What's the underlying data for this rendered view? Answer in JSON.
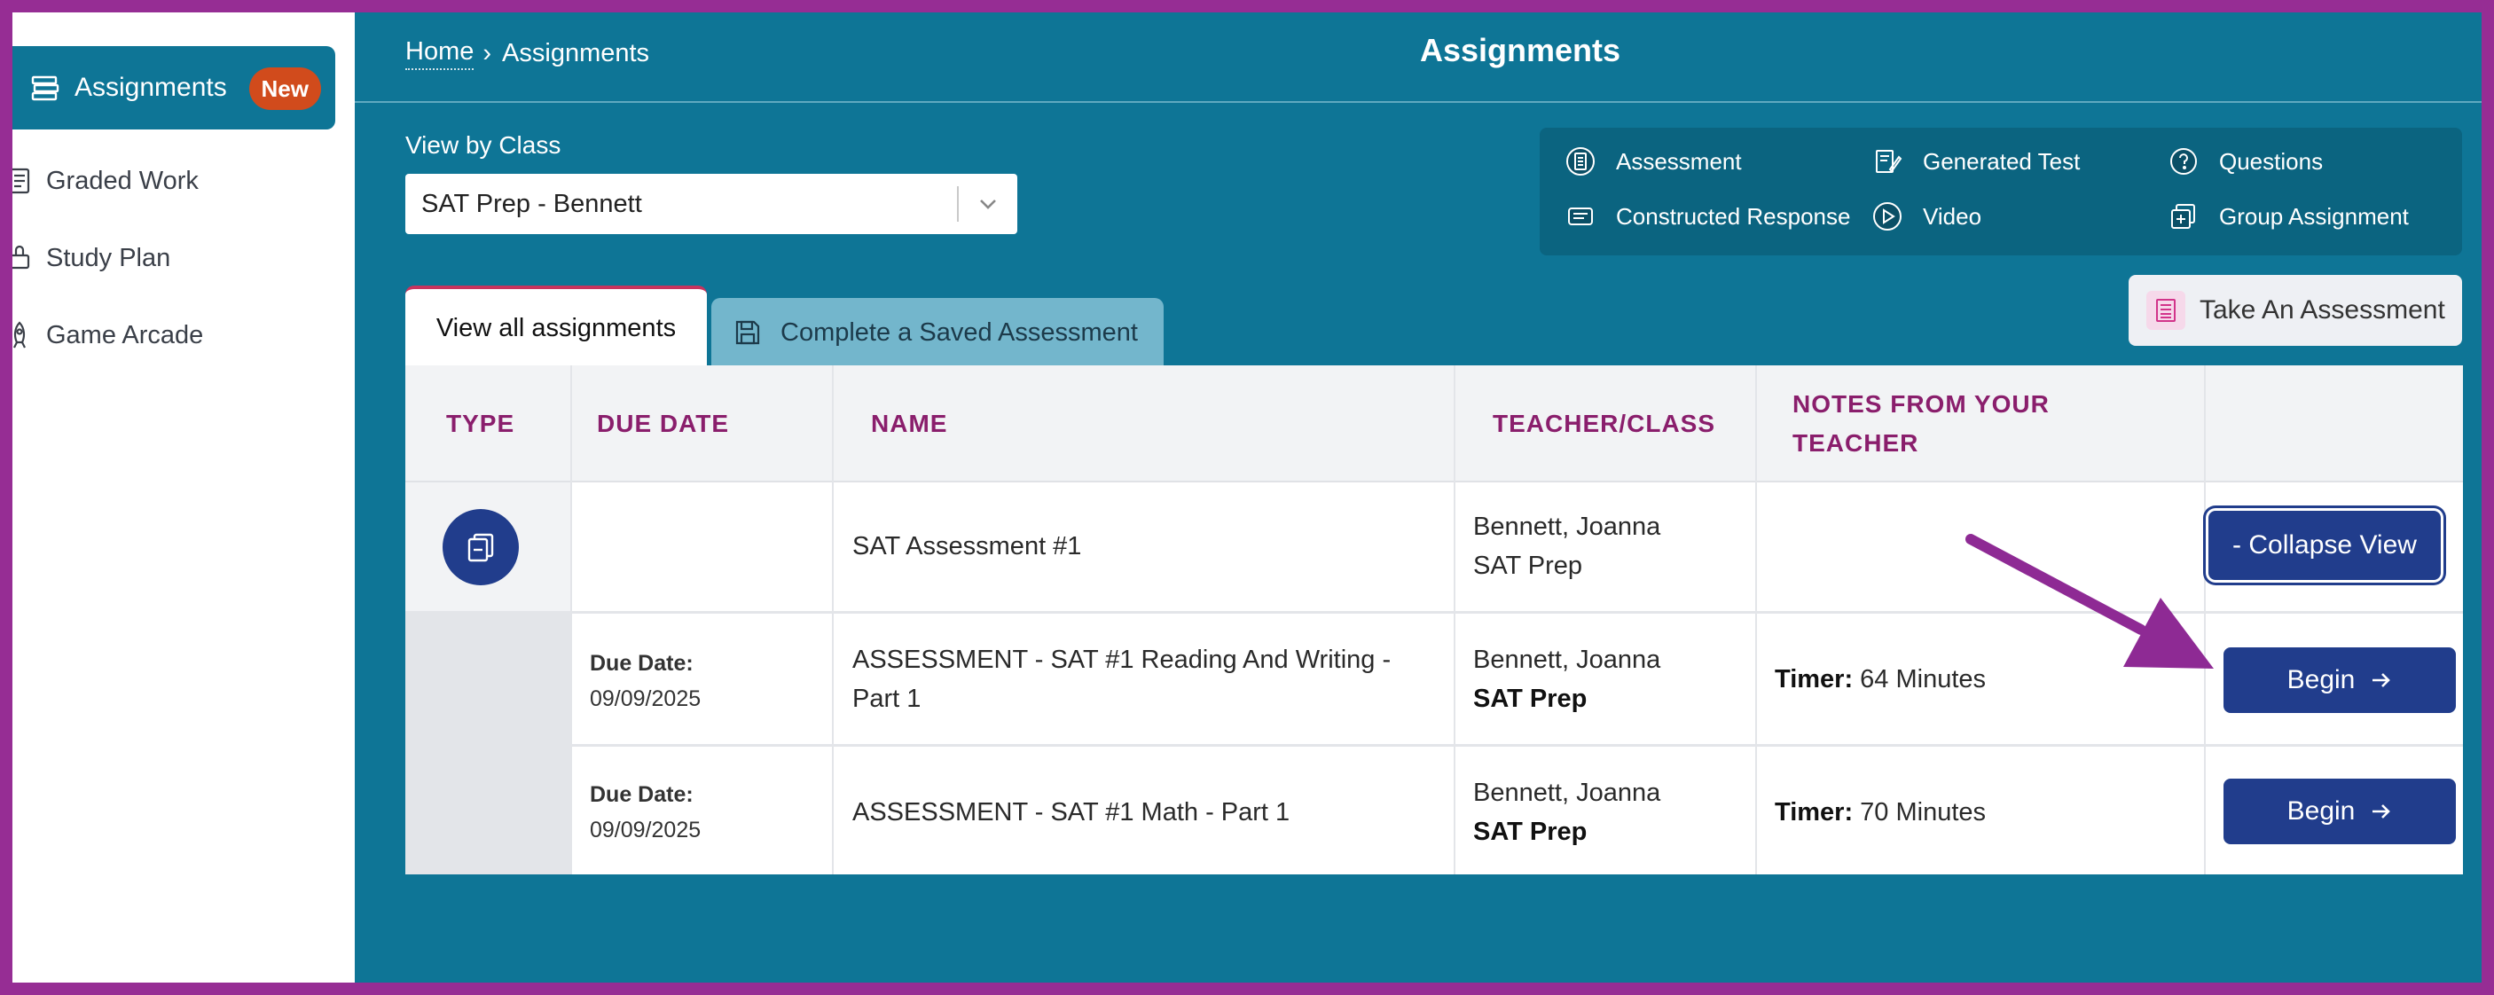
{
  "sidebar": {
    "items": [
      {
        "label": "Assignments",
        "badge": "New",
        "icon": "book-stack-icon",
        "active": true
      },
      {
        "label": "Graded Work",
        "icon": "graded-doc-icon"
      },
      {
        "label": "Study Plan",
        "icon": "study-plan-icon"
      },
      {
        "label": "Game Arcade",
        "icon": "rocket-icon"
      }
    ]
  },
  "header": {
    "breadcrumb": {
      "home": "Home",
      "separator": "›",
      "current": "Assignments"
    },
    "title": "Assignments"
  },
  "filter": {
    "label": "View by Class",
    "value": "SAT Prep - Bennett"
  },
  "legend": [
    {
      "label": "Assessment",
      "icon": "assessment-icon"
    },
    {
      "label": "Generated Test",
      "icon": "generated-test-icon"
    },
    {
      "label": "Questions",
      "icon": "question-circle-icon"
    },
    {
      "label": "Constructed Response",
      "icon": "constructed-response-icon"
    },
    {
      "label": "Video",
      "icon": "video-play-icon"
    },
    {
      "label": "Group Assignment",
      "icon": "group-assignment-icon"
    }
  ],
  "actions": {
    "take_assessment": "Take An Assessment"
  },
  "tabs": [
    {
      "label": "View all assignments",
      "active": true
    },
    {
      "label": "Complete a Saved Assessment",
      "icon": "save-icon",
      "active": false
    }
  ],
  "table": {
    "headers": {
      "type": "TYPE",
      "due_date": "DUE DATE",
      "name": "NAME",
      "teacher": "TEACHER/CLASS",
      "notes_line1": "NOTES FROM YOUR",
      "notes_line2": "TEACHER"
    },
    "group": {
      "name": "SAT Assessment #1",
      "teacher": "Bennett, Joanna",
      "class": "SAT Prep",
      "action": "- Collapse View"
    },
    "rows": [
      {
        "due_label": "Due Date:",
        "due_date": "09/09/2025",
        "name_line1": "ASSESSMENT - SAT #1 Reading And Writing -",
        "name_line2": "Part 1",
        "teacher": "Bennett, Joanna",
        "class": "SAT Prep",
        "timer_label": "Timer:",
        "timer_value": " 64 Minutes",
        "action": "Begin"
      },
      {
        "due_label": "Due Date:",
        "due_date": "09/09/2025",
        "name_line1": "ASSESSMENT - SAT #1 Math - Part 1",
        "teacher": "Bennett, Joanna",
        "class": "SAT Prep",
        "timer_label": "Timer:",
        "timer_value": " 70 Minutes",
        "action": "Begin"
      }
    ]
  },
  "colors": {
    "brand_teal": "#0e7596",
    "frame_purple": "#962d94",
    "button_navy": "#213d8c",
    "header_text": "#8a1e6c",
    "badge_orange": "#d14b1c",
    "annotation_arrow": "#8e2a94"
  }
}
